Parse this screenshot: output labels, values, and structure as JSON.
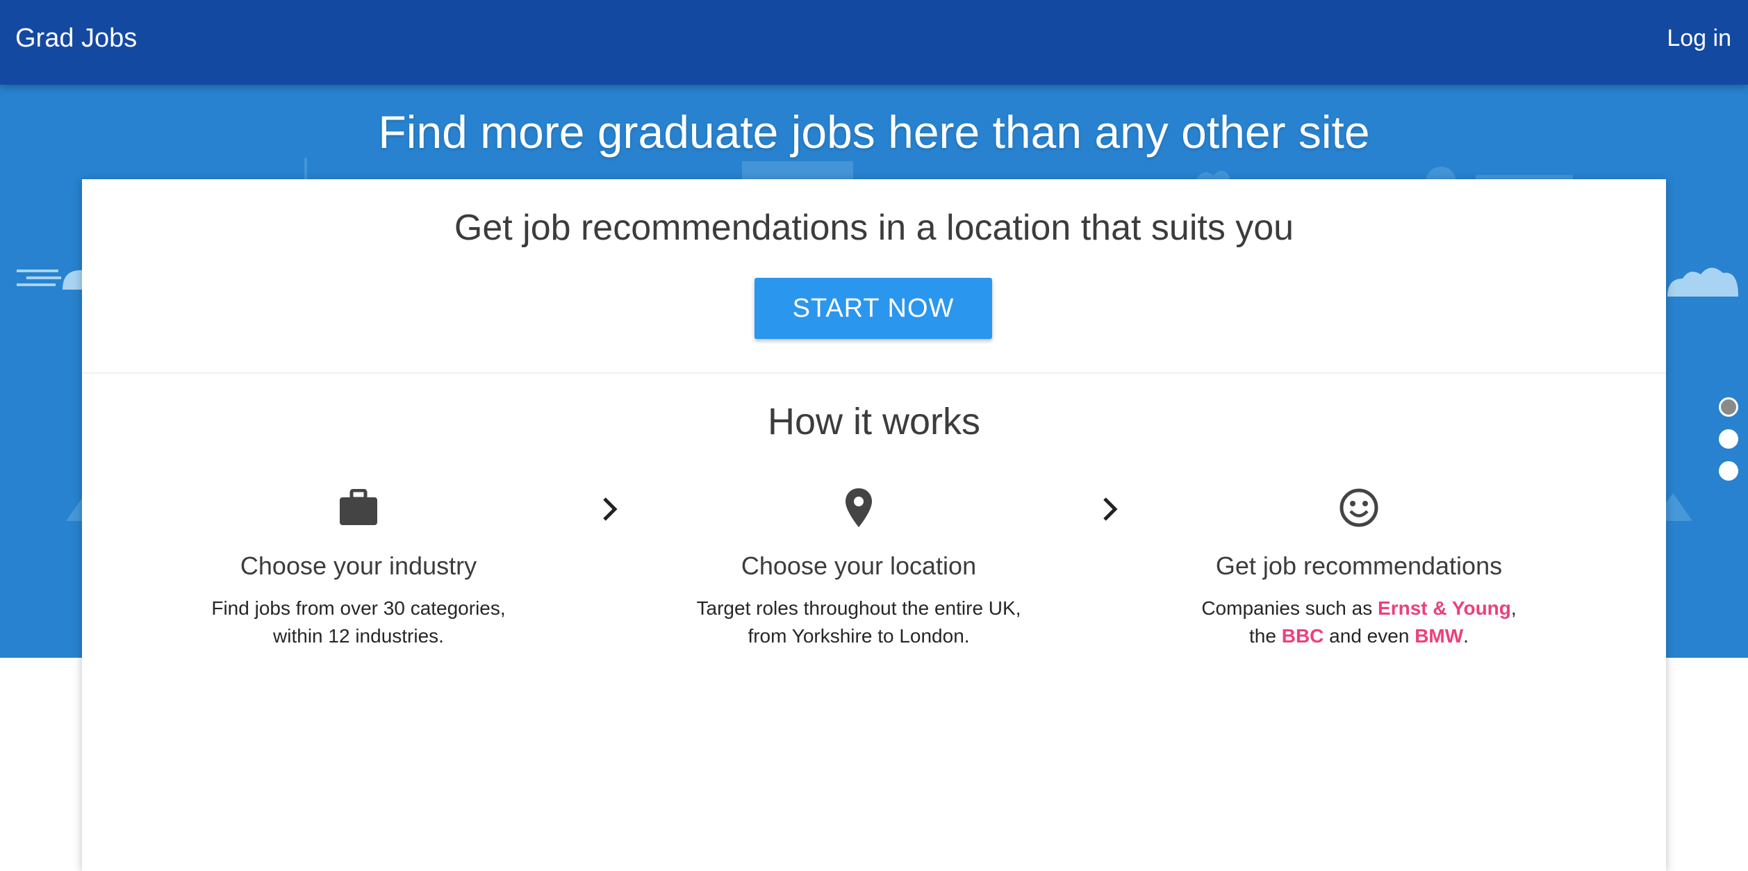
{
  "header": {
    "brand": "Grad Jobs",
    "login": "Log in"
  },
  "hero": {
    "title": "Find more graduate jobs here than any other site"
  },
  "card": {
    "title": "Get job recommendations in a location that suits you",
    "cta": "START NOW",
    "how_title": "How it works"
  },
  "steps": [
    {
      "icon": "briefcase-icon",
      "heading": "Choose your industry",
      "line1": "Find jobs from over 30 categories,",
      "line2": "within 12 industries."
    },
    {
      "icon": "location-pin-icon",
      "heading": "Choose your location",
      "line1": "Target roles throughout the entire UK,",
      "line2": "from Yorkshire to London."
    },
    {
      "icon": "smiley-icon",
      "heading": "Get job recommendations",
      "line1_pre": "Companies such as ",
      "line1_hl": "Ernst & Young",
      "line1_post": ",",
      "line2_pre": "the ",
      "line2_hl1": "BBC",
      "line2_mid": " and even ",
      "line2_hl2": "BMW",
      "line2_post": "."
    }
  ],
  "slider": {
    "count": 3,
    "active": 1
  },
  "colors": {
    "header_bg": "#1449a2",
    "hero_bg": "#2882cf",
    "cta_bg": "#2b96ee",
    "highlight": "#ec407a",
    "text_dark": "#3c3c3c"
  }
}
